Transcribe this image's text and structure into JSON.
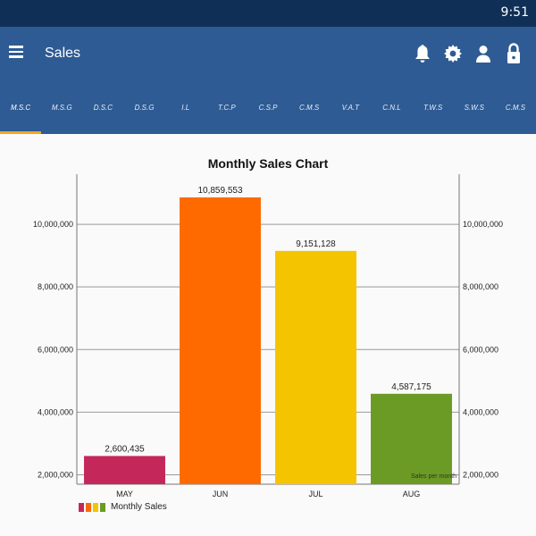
{
  "status_bar": {
    "time": "9:51"
  },
  "app_bar": {
    "title": "Sales",
    "icons": [
      "menu-icon",
      "bell-icon",
      "gear-icon",
      "person-icon",
      "lock-icon"
    ]
  },
  "tabs": [
    {
      "label": "M.S.C",
      "active": true
    },
    {
      "label": "M.S.G"
    },
    {
      "label": "D.S.C"
    },
    {
      "label": "D.S.G"
    },
    {
      "label": "I.L"
    },
    {
      "label": "T.C.P"
    },
    {
      "label": "C.S.P"
    },
    {
      "label": "C.M.S"
    },
    {
      "label": "V.A.T"
    },
    {
      "label": "C.N.L"
    },
    {
      "label": "T.W.S"
    },
    {
      "label": "S.W.S"
    },
    {
      "label": "C.M.S"
    }
  ],
  "colors": {
    "status_bar": "#0f2f57",
    "app_bar": "#2e5b94",
    "tab_indicator": "#f5a623"
  },
  "chart_data": {
    "type": "bar",
    "title": "Monthly Sales Chart",
    "categories": [
      "MAY",
      "JUN",
      "JUL",
      "AUG"
    ],
    "series": [
      {
        "name": "Monthly Sales",
        "values": [
          2600435,
          10859553,
          9151128,
          4587175
        ]
      }
    ],
    "value_labels": [
      "2,600,435",
      "10,859,553",
      "9,151,128",
      "4,587,175"
    ],
    "bar_colors": [
      "#c4285a",
      "#ff6a00",
      "#f5c400",
      "#6b9a25"
    ],
    "y_ticks": [
      "2,000,000",
      "4,000,000",
      "6,000,000",
      "8,000,000",
      "10,000,000"
    ],
    "y_tick_values": [
      2000000,
      4000000,
      6000000,
      8000000,
      10000000
    ],
    "ylim": [
      1700000,
      11600000
    ],
    "annotation": "Sales per month",
    "grid": true,
    "legend_position": "bottom-left"
  }
}
